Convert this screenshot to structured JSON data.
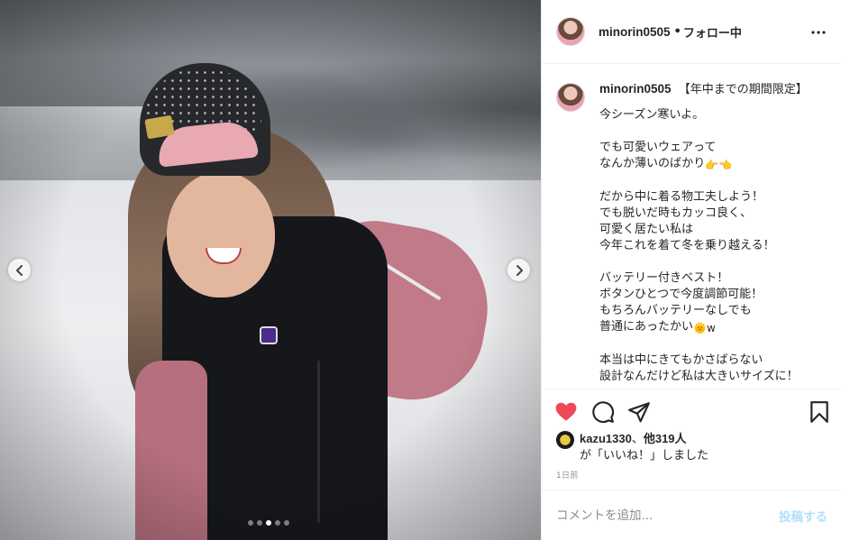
{
  "photo": {
    "prev_icon": "chevron-left-icon",
    "next_icon": "chevron-right-icon",
    "carousel_count": 5,
    "carousel_active_index": 2
  },
  "header": {
    "username": "minorin0505",
    "separator": "•",
    "follow_status": "フォロー中",
    "more_icon": "more-horizontal-icon"
  },
  "caption": {
    "username": "minorin0505",
    "lines": [
      "【年中までの期間限定】",
      "今シーズン寒いよ。",
      "",
      "でも可愛いウェアって",
      "なんか薄いのばかり",
      "",
      "だから中に着る物工夫しよう！",
      "でも脱いだ時もカッコ良く、",
      "可愛く居たい私は",
      "今年これを着て冬を乗り越える！",
      "",
      "バッテリー付きベスト！",
      "ボタンひとつで今度調節可能！",
      "もちろんバッテリーなしでも",
      "普通にあったかい",
      "",
      "本当は中にきてもかさばらない",
      "設計なんだけど私は大きいサイズに！"
    ],
    "line_suffixes": {
      "4": "👉👈",
      "14": "🌞w"
    }
  },
  "actions": {
    "like_icon": "heart-filled-icon",
    "comment_icon": "comment-icon",
    "share_icon": "paper-plane-icon",
    "save_icon": "bookmark-icon",
    "like_color": "#ed4956"
  },
  "likes": {
    "first_liker": "kazu1330",
    "joiner": "、",
    "others": "他319人",
    "suffix": "が「いいね！」しました"
  },
  "date": "1日前",
  "comment": {
    "placeholder": "コメントを追加...",
    "post_label": "投稿する",
    "post_color": "#b2dffc"
  }
}
